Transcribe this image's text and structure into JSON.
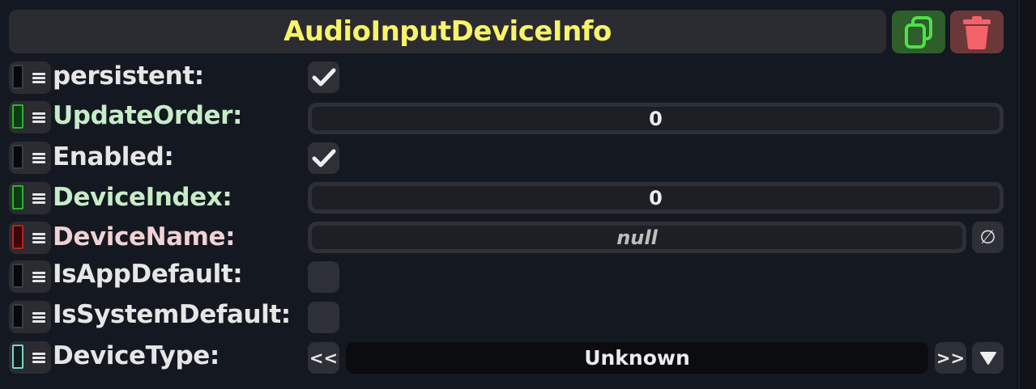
{
  "component": {
    "title": "AudioInputDeviceInfo",
    "copy_icon": "copy-icon",
    "delete_icon": "trash-icon"
  },
  "colors": {
    "title_text": "#f8f36a",
    "label_default": "#e6e6e6",
    "label_value_type": "#c6ecc8",
    "label_reference_type": "#f0d2d4",
    "handle_green": "#2e9d32",
    "handle_red": "#b3261e",
    "handle_cyan": "#7fd5c8"
  },
  "fields": [
    {
      "label": "persistent:",
      "type": "checkbox",
      "checked": true
    },
    {
      "label": "UpdateOrder:",
      "type": "number",
      "value": "0"
    },
    {
      "label": "Enabled:",
      "type": "checkbox",
      "checked": true
    },
    {
      "label": "DeviceIndex:",
      "type": "number",
      "value": "0"
    },
    {
      "label": "DeviceName:",
      "type": "string",
      "value": "null",
      "clear_button": "∅"
    },
    {
      "label": "IsAppDefault:",
      "type": "checkbox",
      "checked": false
    },
    {
      "label": "IsSystemDefault:",
      "type": "checkbox",
      "checked": false
    },
    {
      "label": "DeviceType:",
      "type": "enum",
      "value": "Unknown",
      "prev_button": "<<",
      "next_button": ">>",
      "dropdown_icon": "triangle-down-icon"
    }
  ]
}
